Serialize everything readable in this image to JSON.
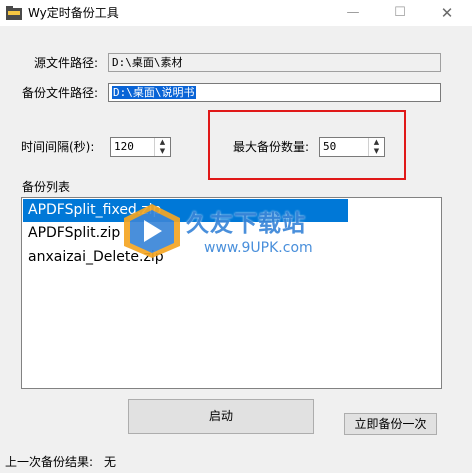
{
  "window": {
    "title": "Wy定时备份工具",
    "minimize_glyph": "—",
    "maximize_glyph": "☐",
    "close_glyph": "✕",
    "icon": "folder-icon"
  },
  "source": {
    "label": "源文件路径:",
    "value": "D:\\桌面\\素材"
  },
  "destination": {
    "label": "备份文件路径:",
    "value": "D:\\桌面\\说明书"
  },
  "interval": {
    "label": "时间间隔(秒):",
    "value": "120"
  },
  "max_count": {
    "label": "最大备份数量:",
    "value": "50"
  },
  "list": {
    "label": "备份列表",
    "items": [
      "APDFSplit_fixed.zip",
      "APDFSplit.zip",
      "anxaizai_Delete.zip"
    ],
    "selected_index": 0
  },
  "buttons": {
    "start": "启动",
    "backup_now": "立即备份一次"
  },
  "status": {
    "label": "上一次备份结果:",
    "value": "无"
  },
  "watermark": {
    "name": "久友下载站",
    "url": "www.9UPK.com"
  },
  "colors": {
    "selection": "#0078d7",
    "highlight": "#e01818",
    "watermark": "#3a86d8"
  }
}
